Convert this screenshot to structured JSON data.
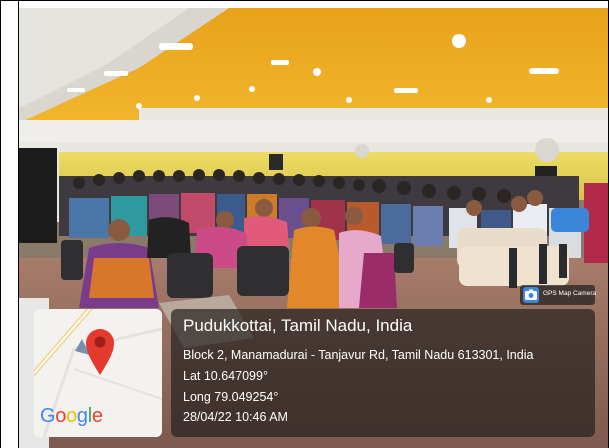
{
  "photo": {
    "subject": "audience seated in auditorium"
  },
  "badge": {
    "label": "GPS Map Camera",
    "icon": "map-camera-icon"
  },
  "map_card": {
    "logo_text": "Google",
    "pin_icon": "map-pin-icon",
    "logo_colors": [
      "#4285F4",
      "#EA4335",
      "#FBBC05",
      "#4285F4",
      "#34A853",
      "#EA4335"
    ]
  },
  "location": {
    "title": "Pudukkottai, Tamil Nadu, India",
    "address": "Block 2, Manamadurai - Tanjavur Rd, Tamil Nadu 613301, India",
    "lat": "Lat 10.647099°",
    "long": "Long 79.049254°",
    "datetime": "28/04/22 10:46 AM"
  }
}
